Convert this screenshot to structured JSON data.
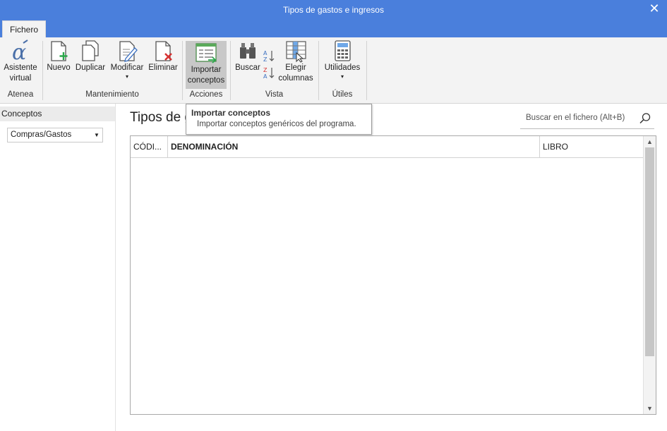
{
  "window": {
    "title": "Tipos de gastos e ingresos",
    "close_glyph": "✕"
  },
  "tabs": {
    "active": "Fichero"
  },
  "ribbon": {
    "groups": {
      "atenea": "Atenea",
      "mantenimiento": "Mantenimiento",
      "acciones": "Acciones",
      "vista": "Vista",
      "utiles": "Útiles"
    },
    "buttons": {
      "asistente_l1": "Asistente",
      "asistente_l2": "virtual",
      "nuevo": "Nuevo",
      "duplicar": "Duplicar",
      "modificar": "Modificar",
      "eliminar": "Eliminar",
      "importar_l1": "Importar",
      "importar_l2": "conceptos",
      "buscar": "Buscar",
      "elegir_l1": "Elegir",
      "elegir_l2": "columnas",
      "utilidades": "Utilidades"
    }
  },
  "left": {
    "header": "Conceptos",
    "combo_value": "Compras/Gastos"
  },
  "main": {
    "title": "Tipos de g",
    "search_placeholder": "Buscar en el fichero (Alt+B)",
    "columns": [
      "CÓDI...",
      "DENOMINACIÓN",
      "LIBRO"
    ]
  },
  "tooltip": {
    "title": "Importar conceptos",
    "description": "Importar conceptos genéricos del programa."
  },
  "colors": {
    "titlebar": "#4a7fdc",
    "ribbon_bg": "#f3f3f3",
    "active_button": "#c8c8c8"
  }
}
